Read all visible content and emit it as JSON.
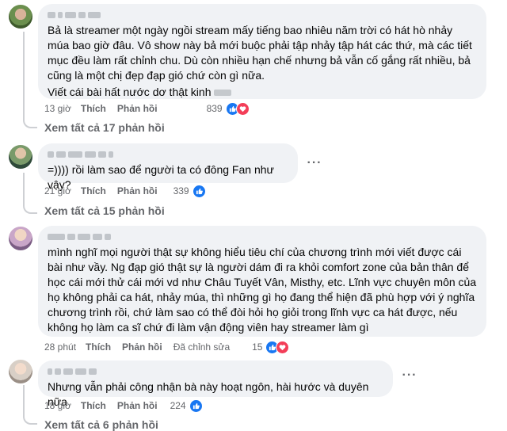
{
  "comments": [
    {
      "name_hidden": true,
      "text": "Bả là streamer một ngày ngồi stream mấy tiếng bao nhiêu năm trời có hát hò nhảy múa bao giờ đâu. Vô show này bả mới buộc phải tập nhảy tập hát các thứ, mà các tiết mục đều làm rất chỉnh chu. Dù còn nhiều hạn chế nhưng bả vẫn cố gắng rất nhiều, bả cũng là một chị đẹp đạp gió chứ còn gì nữa.",
      "text2": "Viết cái bài hất nước dơ thật kinh",
      "time": "13 giờ",
      "like_label": "Thích",
      "reply_label": "Phản hồi",
      "reaction_count": "839",
      "reactions": [
        "like-icon",
        "love-icon"
      ],
      "view_replies": "Xem tất cả 17 phản hồi"
    },
    {
      "name_hidden": true,
      "text": "=)))) rồi làm sao để người ta có đông Fan như vậy?",
      "time": "21 giờ",
      "like_label": "Thích",
      "reply_label": "Phản hồi",
      "reaction_count": "339",
      "reactions": [
        "like-icon"
      ],
      "view_replies": "Xem tất cả 15 phản hồi"
    },
    {
      "name_hidden": true,
      "text": "mình nghĩ mọi người thật sự không hiểu tiêu chí của chương trình mới viết được cái bài như vầy. Ng đạp gió thật sự là người dám đi ra khỏi comfort zone của bản thân để học cái mới thử cái mới vd như Châu Tuyết Vân, Misthy, etc. Lĩnh vực chuyên môn của họ không phải ca hát, nhảy múa, thì những gì họ đang thể hiện đã phù hợp với ý nghĩa chương trình rồi, chứ làm sao có thể đòi hỏi họ giỏi trong lĩnh vực ca hát được, nếu không họ làm ca sĩ chứ đi làm vận động viên hay streamer làm gì",
      "time": "28 phút",
      "like_label": "Thích",
      "reply_label": "Phản hồi",
      "edited_label": "Đã chỉnh sửa",
      "reaction_count": "15",
      "reactions": [
        "like-icon",
        "love-icon"
      ]
    },
    {
      "name_hidden": true,
      "text": "Nhưng vẫn phải công nhận bà này hoạt ngôn, hài hước và duyên nữa",
      "time": "18 giờ",
      "like_label": "Thích",
      "reply_label": "Phản hồi",
      "reaction_count": "224",
      "reactions": [
        "like-icon"
      ],
      "view_replies": "Xem tất cả 6 phản hồi"
    }
  ],
  "colors": {
    "bubble": "#f0f2f5",
    "meta": "#65676b",
    "like": "#1877f2",
    "love": "#f33e58",
    "thread": "#ced0d4"
  }
}
